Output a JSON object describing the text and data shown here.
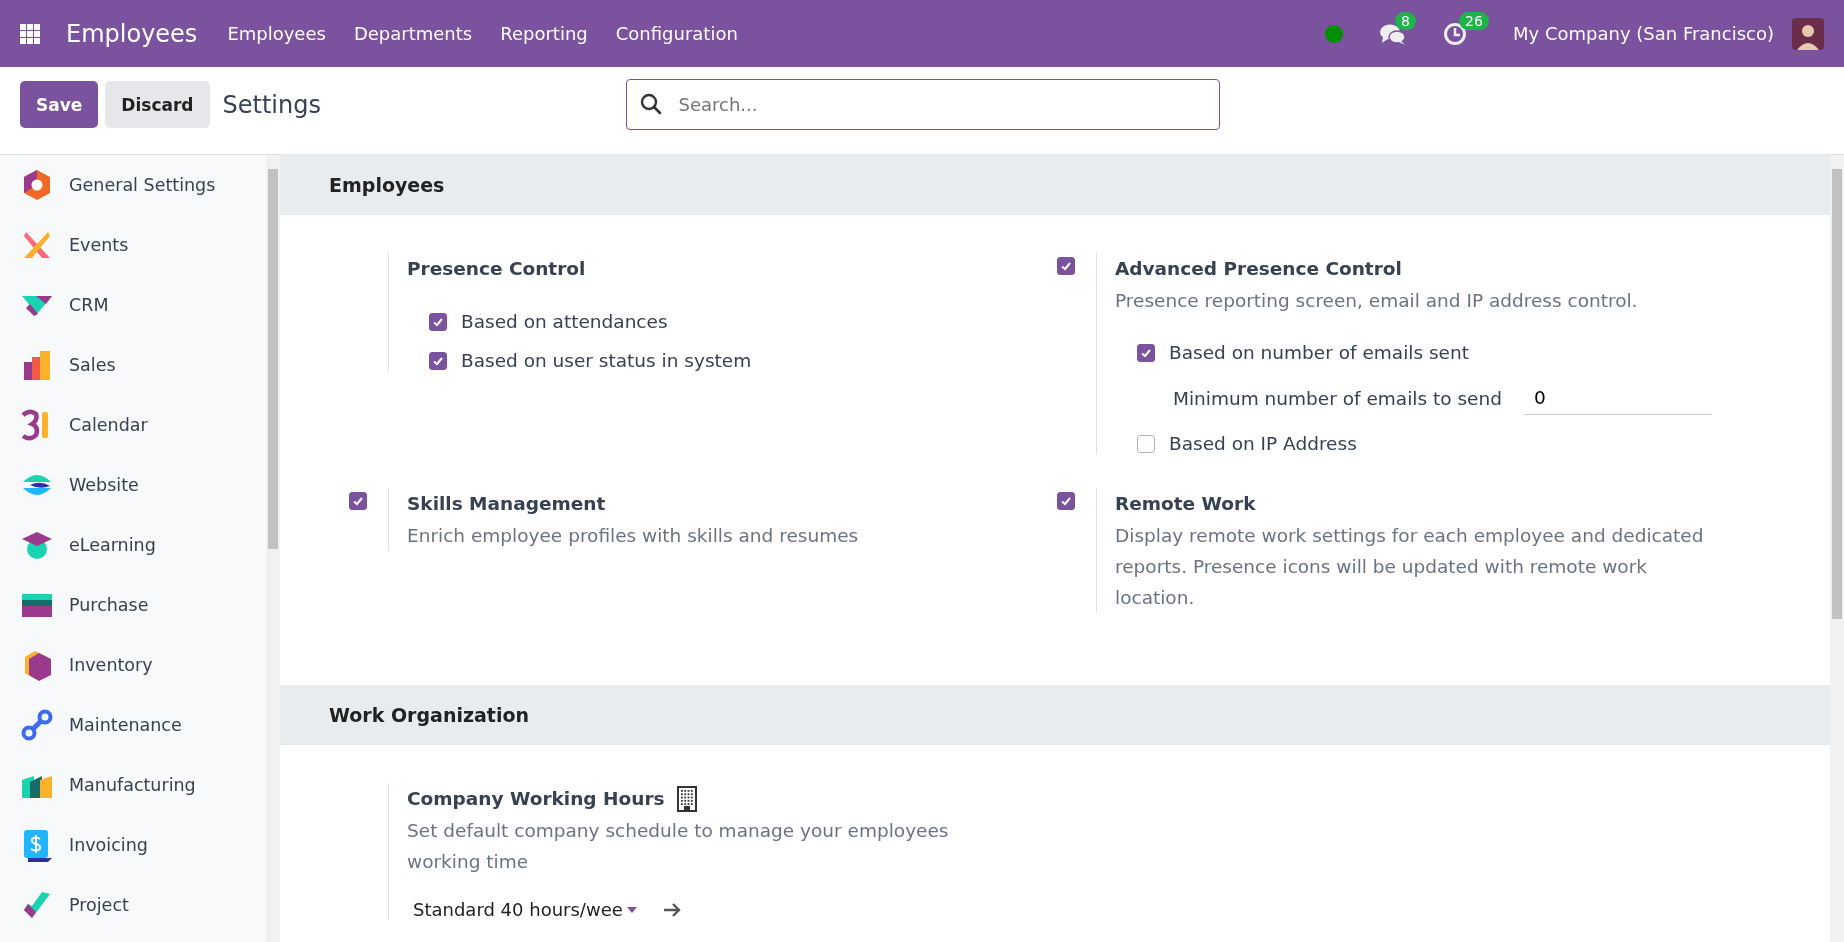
{
  "navbar": {
    "app_title": "Employees",
    "menu": [
      "Employees",
      "Departments",
      "Reporting",
      "Configuration"
    ],
    "messages_count": "8",
    "activities_count": "26",
    "company": "My Company (San Francisco)"
  },
  "control_panel": {
    "buttons": [
      {
        "label": "Save",
        "kind": "primary"
      },
      {
        "label": "Discard",
        "kind": "secondary"
      }
    ],
    "title": "Settings",
    "search": {
      "placeholder": "Search..."
    }
  },
  "sidebar": {
    "items": [
      {
        "label": "General Settings"
      },
      {
        "label": "Events"
      },
      {
        "label": "CRM"
      },
      {
        "label": "Sales"
      },
      {
        "label": "Calendar"
      },
      {
        "label": "Website"
      },
      {
        "label": "eLearning"
      },
      {
        "label": "Purchase"
      },
      {
        "label": "Inventory"
      },
      {
        "label": "Maintenance"
      },
      {
        "label": "Manufacturing"
      },
      {
        "label": "Invoicing"
      },
      {
        "label": "Project"
      }
    ]
  },
  "sections": [
    {
      "title": "Employees",
      "settings": [
        {
          "kind": "group",
          "title": "Presence Control",
          "options": [
            {
              "kind": "checkbox",
              "label": "Based on attendances",
              "checked": true
            },
            {
              "kind": "checkbox",
              "label": "Based on user status in system",
              "checked": true
            }
          ]
        },
        {
          "kind": "toggle",
          "checked": true,
          "title": "Advanced Presence Control",
          "description": "Presence reporting screen, email and IP address control.",
          "options": [
            {
              "kind": "checkbox",
              "label": "Based on number of emails sent",
              "checked": true
            },
            {
              "kind": "number",
              "label": "Minimum number of emails to send",
              "value": "0"
            },
            {
              "kind": "checkbox",
              "label": "Based on IP Address",
              "checked": false
            }
          ]
        },
        {
          "kind": "toggle",
          "checked": true,
          "title": "Skills Management",
          "description": "Enrich employee profiles with skills and resumes"
        },
        {
          "kind": "toggle",
          "checked": true,
          "title": "Remote Work",
          "description": "Display remote work settings for each employee and dedicated reports. Presence icons will be updated with remote work location."
        }
      ]
    },
    {
      "title": "Work Organization",
      "settings": [
        {
          "kind": "group",
          "title": "Company Working Hours",
          "company_specific": true,
          "description": "Set default company schedule to manage your employees working time",
          "select": {
            "value": "Standard 40 hours/wee"
          }
        }
      ]
    }
  ]
}
